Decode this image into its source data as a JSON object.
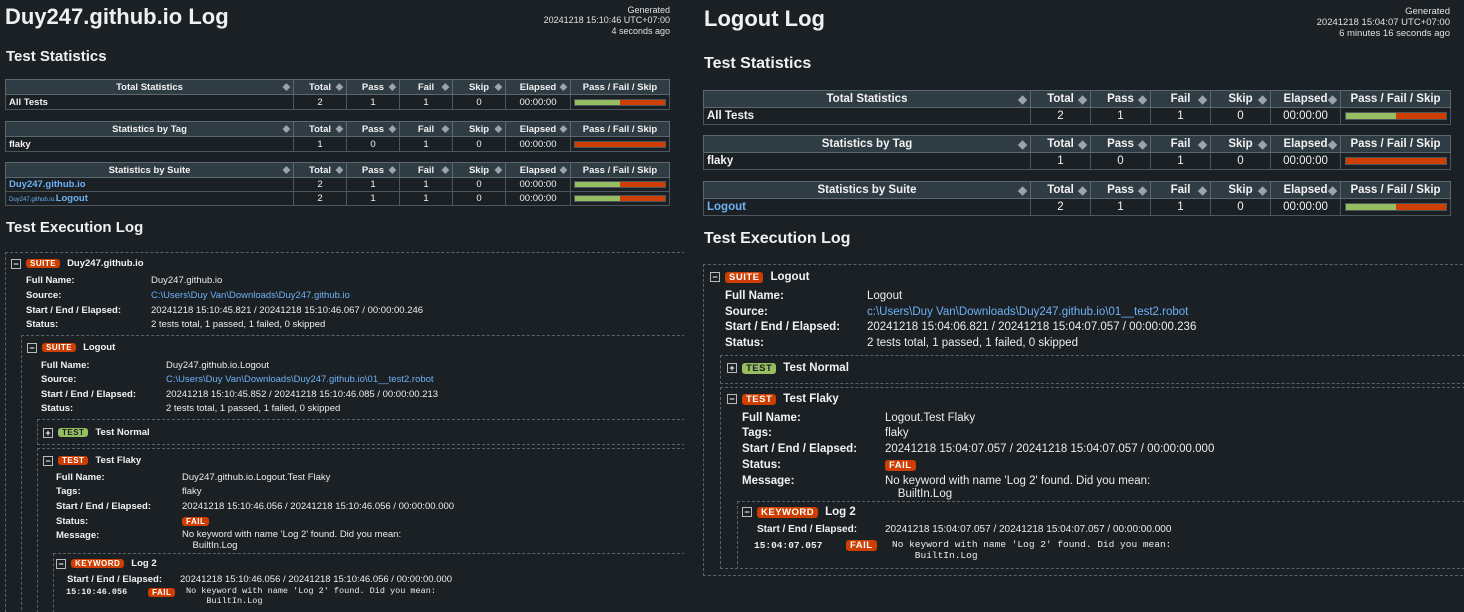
{
  "left": {
    "title": "Duy247.github.io Log",
    "generated_label": "Generated",
    "generated_date": "20241218 15:10:46 UTC+07:00",
    "generated_ago": "4 seconds ago",
    "stats_heading": "Test Statistics",
    "headers": [
      "Total",
      "Pass",
      "Fail",
      "Skip",
      "Elapsed",
      "Pass / Fail / Skip"
    ],
    "total_header": "Total Statistics",
    "total_row": {
      "name": "All Tests",
      "total": "2",
      "pass": "1",
      "fail": "1",
      "skip": "0",
      "elapsed": "00:00:00",
      "pass_frac": 0.5
    },
    "tag_header": "Statistics by Tag",
    "tag_row": {
      "name": "flaky",
      "total": "1",
      "pass": "0",
      "fail": "1",
      "skip": "0",
      "elapsed": "00:00:00",
      "pass_frac": 0
    },
    "suite_header": "Statistics by Suite",
    "suite_rows": [
      {
        "name": "Duy247.github.io",
        "total": "2",
        "pass": "1",
        "fail": "1",
        "skip": "0",
        "elapsed": "00:00:00",
        "pass_frac": 0.5
      },
      {
        "prefix": "Duy247.github.io.",
        "name": "Logout",
        "total": "2",
        "pass": "1",
        "fail": "1",
        "skip": "0",
        "elapsed": "00:00:00",
        "pass_frac": 0.5
      }
    ],
    "exec_heading": "Test Execution Log",
    "suite_label": "SUITE",
    "test_label": "TEST",
    "kw_label": "KEYWORD",
    "fail_label": "FAIL",
    "full_name_k": "Full Name:",
    "source_k": "Source:",
    "times_k": "Start / End / Elapsed:",
    "status_k": "Status:",
    "tags_k": "Tags:",
    "message_k": "Message:",
    "root": {
      "name": "Duy247.github.io",
      "full_name": "Duy247.github.io",
      "source": "C:\\Users\\Duy Van\\Downloads\\Duy247.github.io",
      "times": "20241218 15:10:45.821 / 20241218 15:10:46.067 / 00:00:00.246",
      "status": "2 tests total, 1 passed, 1 failed, 0 skipped"
    },
    "sub": {
      "name": "Logout",
      "full_name": "Duy247.github.io.Logout",
      "source": "C:\\Users\\Duy Van\\Downloads\\Duy247.github.io\\01__test2.robot",
      "times": "20241218 15:10:45.852 / 20241218 15:10:46.085 / 00:00:00.213",
      "status": "2 tests total, 1 passed, 1 failed, 0 skipped"
    },
    "test_normal": "Test Normal",
    "test_flaky": {
      "name": "Test Flaky",
      "full_name": "Duy247.github.io.Logout.Test Flaky",
      "tags": "flaky",
      "times": "20241218 15:10:46.056 / 20241218 15:10:46.056 / 00:00:00.000",
      "message": "No keyword with name 'Log 2' found. Did you mean:\n    BuiltIn.Log"
    },
    "keyword": {
      "name": "Log 2",
      "times": "20241218 15:10:46.056 / 20241218 15:10:46.056 / 00:00:00.000",
      "timestamp": "15:10:46.056",
      "message": "No keyword with name 'Log 2' found. Did you mean:\n    BuiltIn.Log"
    }
  },
  "right": {
    "title": "Logout Log",
    "generated_label": "Generated",
    "generated_date": "20241218 15:04:07 UTC+07:00",
    "generated_ago": "6 minutes 16 seconds ago",
    "stats_heading": "Test Statistics",
    "headers": [
      "Total",
      "Pass",
      "Fail",
      "Skip",
      "Elapsed",
      "Pass / Fail / Skip"
    ],
    "total_header": "Total Statistics",
    "total_row": {
      "name": "All Tests",
      "total": "2",
      "pass": "1",
      "fail": "1",
      "skip": "0",
      "elapsed": "00:00:00",
      "pass_frac": 0.5
    },
    "tag_header": "Statistics by Tag",
    "tag_row": {
      "name": "flaky",
      "total": "1",
      "pass": "0",
      "fail": "1",
      "skip": "0",
      "elapsed": "00:00:00",
      "pass_frac": 0
    },
    "suite_header": "Statistics by Suite",
    "suite_rows": [
      {
        "name": "Logout",
        "total": "2",
        "pass": "1",
        "fail": "1",
        "skip": "0",
        "elapsed": "00:00:00",
        "pass_frac": 0.5
      }
    ],
    "exec_heading": "Test Execution Log",
    "suite_label": "SUITE",
    "test_label": "TEST",
    "kw_label": "KEYWORD",
    "fail_label": "FAIL",
    "full_name_k": "Full Name:",
    "source_k": "Source:",
    "times_k": "Start / End / Elapsed:",
    "status_k": "Status:",
    "tags_k": "Tags:",
    "message_k": "Message:",
    "root": {
      "name": "Logout",
      "full_name": "Logout",
      "source": "c:\\Users\\Duy Van\\Downloads\\Duy247.github.io\\01__test2.robot",
      "times": "20241218 15:04:06.821 / 20241218 15:04:07.057 / 00:00:00.236",
      "status": "2 tests total, 1 passed, 1 failed, 0 skipped"
    },
    "test_normal": "Test Normal",
    "test_flaky": {
      "name": "Test Flaky",
      "full_name": "Logout.Test Flaky",
      "tags": "flaky",
      "times": "20241218 15:04:07.057 / 20241218 15:04:07.057 / 00:00:00.000",
      "message": "No keyword with name 'Log 2' found. Did you mean:\n    BuiltIn.Log"
    },
    "keyword": {
      "name": "Log 2",
      "times": "20241218 15:04:07.057 / 20241218 15:04:07.057 / 00:00:00.000",
      "timestamp": "15:04:07.057",
      "message": "No keyword with name 'Log 2' found. Did you mean:\n    BuiltIn.Log"
    }
  },
  "colors": {
    "pass": "#97bd61",
    "fail": "#ce3e01",
    "link": "#6cb2f5",
    "background": "#1b2025"
  }
}
